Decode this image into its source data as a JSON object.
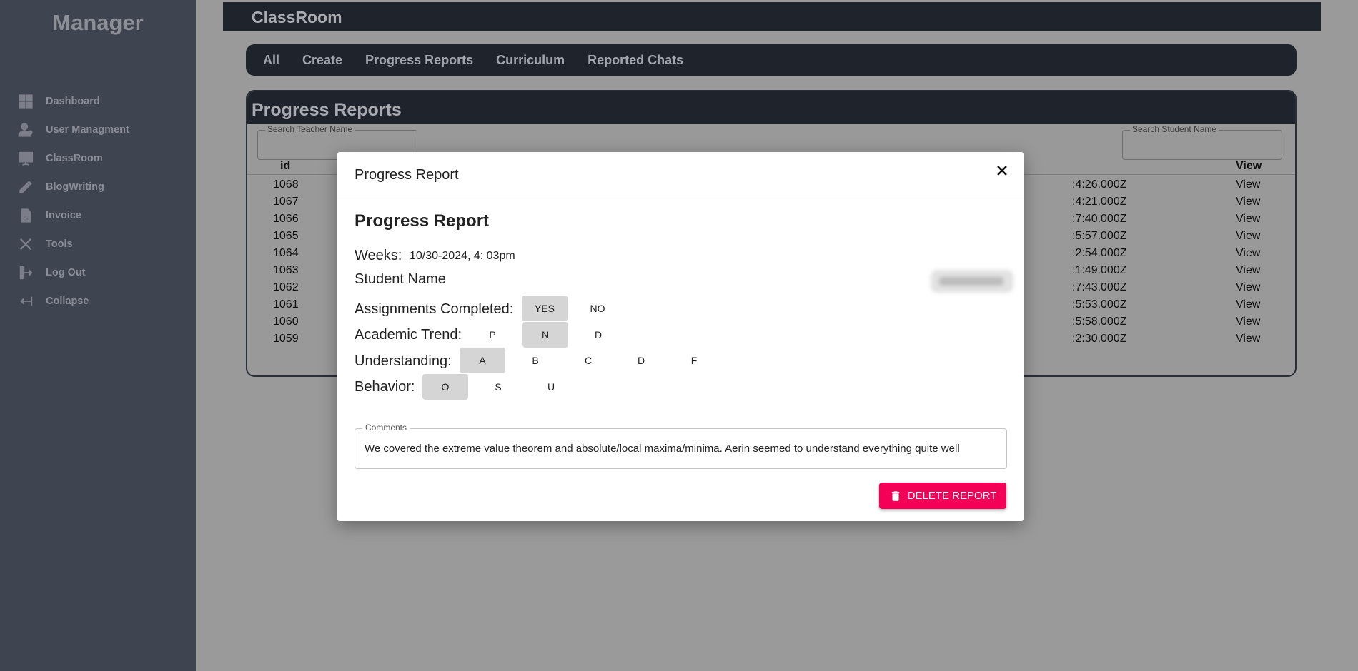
{
  "sidebar": {
    "brand": "Manager",
    "items": [
      {
        "label": "Dashboard",
        "icon": "dashboard-icon"
      },
      {
        "label": "User Managment",
        "icon": "user-icon"
      },
      {
        "label": "ClassRoom",
        "icon": "presentation-icon"
      },
      {
        "label": "BlogWriting",
        "icon": "pencil-icon"
      },
      {
        "label": "Invoice",
        "icon": "invoice-icon"
      },
      {
        "label": "Tools",
        "icon": "tools-icon"
      },
      {
        "label": "Log Out",
        "icon": "logout-icon"
      },
      {
        "label": "Collapse",
        "icon": "collapse-icon"
      }
    ]
  },
  "topbar": {
    "title": "ClassRoom"
  },
  "tabs": [
    "All",
    "Create",
    "Progress Reports",
    "Curriculum",
    "Reported Chats"
  ],
  "panel": {
    "title": "Progress Reports",
    "search_teacher_label": "Search Teacher Name",
    "search_student_label": "Search Student Name",
    "columns": {
      "id": "id",
      "view": "View"
    },
    "rows": [
      {
        "id": "1068",
        "date": ":4:26.000Z",
        "view": "View"
      },
      {
        "id": "1067",
        "date": ":4:21.000Z",
        "view": "View"
      },
      {
        "id": "1066",
        "date": ":7:40.000Z",
        "view": "View"
      },
      {
        "id": "1065",
        "date": ":5:57.000Z",
        "view": "View"
      },
      {
        "id": "1064",
        "date": ":2:54.000Z",
        "view": "View"
      },
      {
        "id": "1063",
        "date": ":1:49.000Z",
        "view": "View"
      },
      {
        "id": "1062",
        "date": ":7:43.000Z",
        "view": "View"
      },
      {
        "id": "1061",
        "date": ":5:53.000Z",
        "view": "View"
      },
      {
        "id": "1060",
        "date": ":5:58.000Z",
        "view": "View"
      },
      {
        "id": "1059",
        "date": ":2:30.000Z",
        "view": "View"
      }
    ]
  },
  "modal": {
    "header_title": "Progress Report",
    "heading": "Progress Report",
    "weeks_label": "Weeks:",
    "weeks_value": "10/30-2024, 4: 03pm",
    "student_name_label": "Student Name",
    "assignments": {
      "label": "Assignments Completed:",
      "options": [
        "YES",
        "NO"
      ],
      "selected": "YES"
    },
    "trend": {
      "label": "Academic Trend:",
      "options": [
        "P",
        "N",
        "D"
      ],
      "selected": "N"
    },
    "understanding": {
      "label": "Understanding:",
      "options": [
        "A",
        "B",
        "C",
        "D",
        "F"
      ],
      "selected": "A"
    },
    "behavior": {
      "label": "Behavior:",
      "options": [
        "O",
        "S",
        "U"
      ],
      "selected": "O"
    },
    "comments_label": "Comments",
    "comments_value": "We covered the extreme value theorem and absolute/local maxima/minima.  Aerin seemed to understand everything quite well",
    "delete_label": "DELETE REPORT"
  },
  "colors": {
    "delete_button": "#f50057",
    "sidebar": "#3f4451",
    "header": "#1e232c"
  }
}
